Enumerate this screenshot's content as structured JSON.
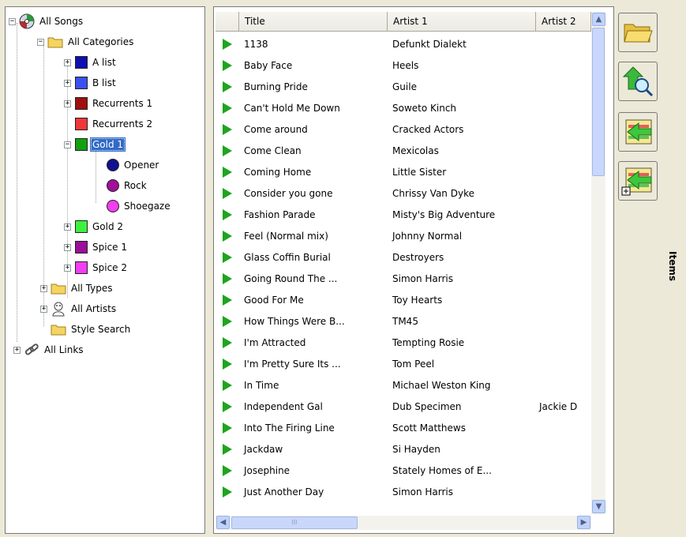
{
  "tree": {
    "root_all_songs": "All Songs",
    "all_categories": "All Categories",
    "categories": [
      {
        "label": "A list",
        "color": "#1010b0"
      },
      {
        "label": "B list",
        "color": "#3a50f0"
      },
      {
        "label": "Recurrents 1",
        "color": "#a00f0f"
      },
      {
        "label": "Recurrents 2",
        "color": "#f03838"
      },
      {
        "label": "Gold 1",
        "color": "#12a012"
      },
      {
        "label": "Gold 2",
        "color": "#3ef03e"
      },
      {
        "label": "Spice 1",
        "color": "#9a0f9a"
      },
      {
        "label": "Spice 2",
        "color": "#f03ef0"
      }
    ],
    "subcategories": [
      {
        "label": "Opener",
        "color": "#101090"
      },
      {
        "label": "Rock",
        "color": "#a0109a"
      },
      {
        "label": "Shoegaze",
        "color": "#f03ef0"
      }
    ],
    "all_types": "All Types",
    "all_artists": "All Artists",
    "style_search": "Style Search",
    "all_links": "All Links",
    "selected": "Gold 1"
  },
  "table": {
    "columns": [
      "Title",
      "Artist 1",
      "Artist 2"
    ],
    "rows": [
      [
        "1138",
        "Defunkt Dialekt",
        ""
      ],
      [
        "Baby Face",
        "Heels",
        ""
      ],
      [
        "Burning Pride",
        "Guile",
        ""
      ],
      [
        "Can't Hold Me Down",
        "Soweto Kinch",
        ""
      ],
      [
        "Come around",
        "Cracked Actors",
        ""
      ],
      [
        "Come Clean",
        "Mexicolas",
        ""
      ],
      [
        "Coming Home",
        "Little Sister",
        ""
      ],
      [
        "Consider you gone",
        "Chrissy Van Dyke",
        ""
      ],
      [
        "Fashion Parade",
        "Misty's Big Adventure",
        ""
      ],
      [
        "Feel (Normal mix)",
        "Johnny Normal",
        ""
      ],
      [
        "Glass Coffin Burial",
        "Destroyers",
        ""
      ],
      [
        "Going Round The ...",
        "Simon Harris",
        ""
      ],
      [
        "Good For Me",
        "Toy Hearts",
        ""
      ],
      [
        "How Things Were B...",
        "TM45",
        ""
      ],
      [
        "I'm Attracted",
        "Tempting Rosie",
        ""
      ],
      [
        "I'm Pretty Sure Its ...",
        "Tom Peel",
        ""
      ],
      [
        "In Time",
        "Michael Weston King",
        ""
      ],
      [
        "Independent Gal",
        "Dub Specimen",
        "Jackie D"
      ],
      [
        "Into The Firing Line",
        "Scott Matthews",
        ""
      ],
      [
        "Jackdaw",
        "Si Hayden",
        ""
      ],
      [
        "Josephine",
        "Stately Homes of E...",
        ""
      ],
      [
        "Just Another Day",
        "Simon Harris",
        ""
      ]
    ]
  },
  "side_panel": {
    "label": "Items"
  },
  "icons": {
    "open": "open-folder-icon",
    "search": "search-up-icon",
    "add": "add-items-icon",
    "add_expand": "add-items-expand-icon"
  }
}
